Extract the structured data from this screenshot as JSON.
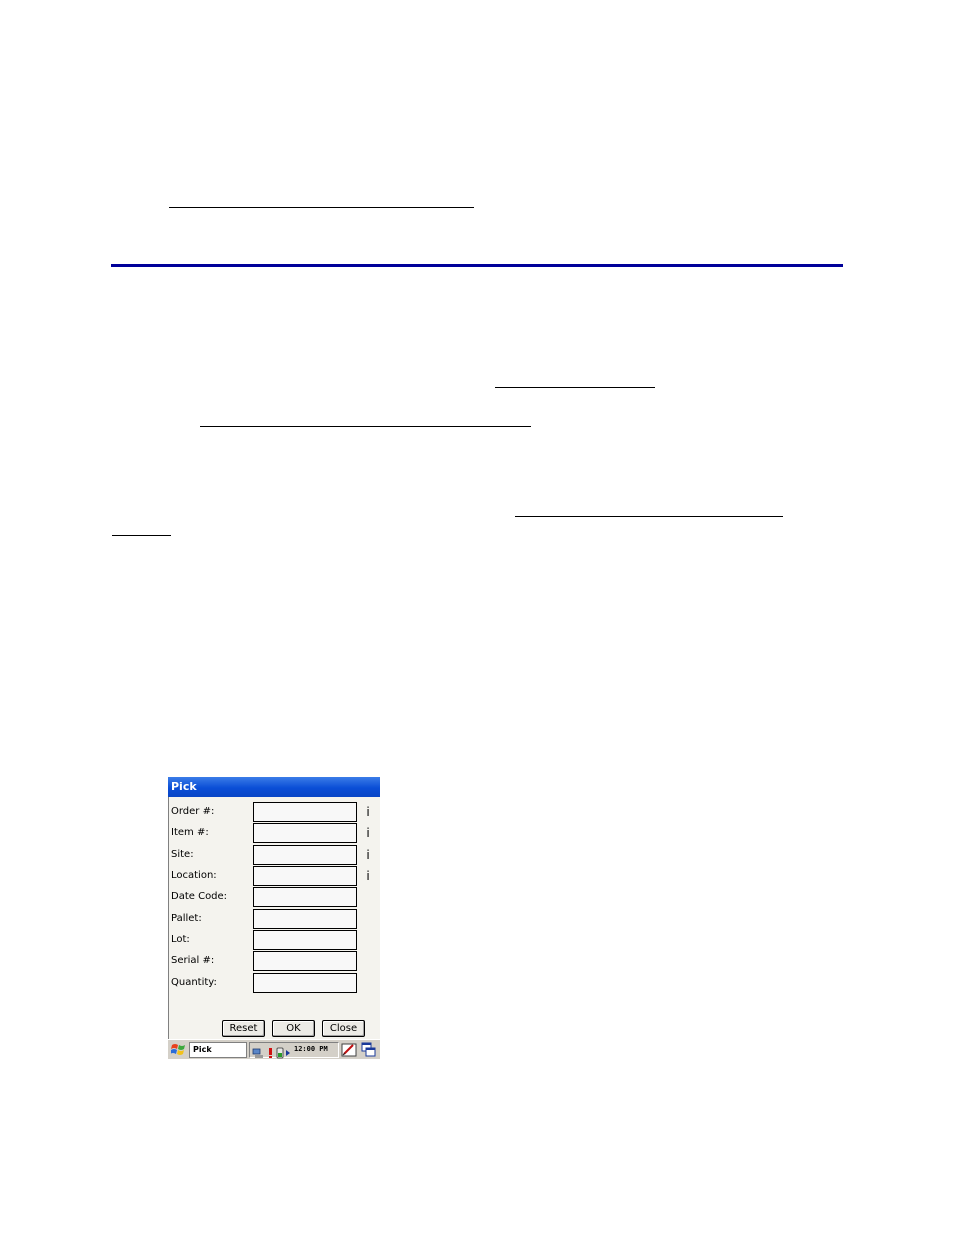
{
  "window": {
    "title": "Pick"
  },
  "form": {
    "fields": [
      {
        "label": "Order #:",
        "value": "",
        "info": "i"
      },
      {
        "label": "Item #:",
        "value": "",
        "info": "i"
      },
      {
        "label": "Site:",
        "value": "",
        "info": "i"
      },
      {
        "label": "Location:",
        "value": "",
        "info": "i"
      },
      {
        "label": "Date Code:",
        "value": ""
      },
      {
        "label": "Pallet:",
        "value": ""
      },
      {
        "label": "Lot:",
        "value": ""
      },
      {
        "label": "Serial #:",
        "value": ""
      },
      {
        "label": "Quantity:",
        "value": ""
      }
    ]
  },
  "buttons": {
    "reset": "Reset",
    "ok": "OK",
    "close": "Close"
  },
  "taskbar": {
    "task_label": "Pick",
    "clock": "12:00 PM"
  },
  "colors": {
    "titlebar": "#0a4ed6",
    "rule": "#000099"
  },
  "icons": {
    "start": "windows-flag-icon",
    "network": "network-icon",
    "battery": "battery-icon",
    "sip": "keyboard-pen-icon",
    "windows": "window-switch-icon"
  }
}
